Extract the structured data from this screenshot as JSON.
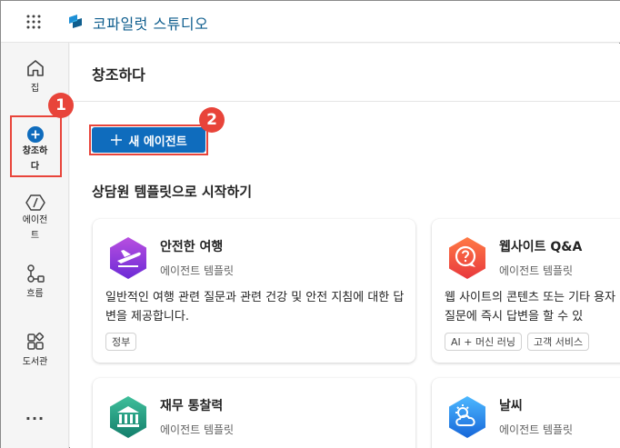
{
  "app": {
    "title": "코파일럿 스튜디오"
  },
  "rail": {
    "items": [
      {
        "id": "home",
        "label": "집"
      },
      {
        "id": "create",
        "label": "창조하\n다"
      },
      {
        "id": "agents",
        "label": "에이전\n트"
      },
      {
        "id": "flows",
        "label": "흐름"
      },
      {
        "id": "library",
        "label": "도서관"
      }
    ],
    "more_label": "..."
  },
  "page": {
    "title": "창조하다",
    "new_agent_button": "새 에이전트",
    "section_title": "상담원 템플릿으로 시작하기"
  },
  "cards": [
    {
      "title": "안전한 여행",
      "subtitle": "에이전트 템플릿",
      "description": "일반적인 여행 관련 질문과 관련 건강 및 안전 지침에 대한 답변을 제공합니다.",
      "tags": [
        "정부"
      ],
      "icon": "airplane-icon",
      "color_top": "#b84fe0",
      "color_bottom": "#6c2ad6"
    },
    {
      "title": "웹사이트 Q&A",
      "subtitle": "에이전트 템플릿",
      "description": "웹 사이트의 콘텐츠 또는 기타 용자 질문에 즉시 답변을 할 수 있",
      "tags": [
        "AI + 머신 러닝",
        "고객 서비스"
      ],
      "icon": "chat-question-icon",
      "color_top": "#ff7a45",
      "color_bottom": "#e8383d"
    },
    {
      "title": "재무 통찰력",
      "subtitle": "에이전트 템플릿",
      "icon": "bank-icon",
      "color_top": "#3fbf9b",
      "color_bottom": "#137e6b"
    },
    {
      "title": "날씨",
      "subtitle": "에이전트 템플릿",
      "icon": "weather-icon",
      "color_top": "#4db8ff",
      "color_bottom": "#1666d9"
    }
  ],
  "callouts": [
    "1",
    "2"
  ],
  "colors": {
    "accent": "#0f6cbd",
    "callout": "#e8443a",
    "brand": "#0f5e8e"
  }
}
